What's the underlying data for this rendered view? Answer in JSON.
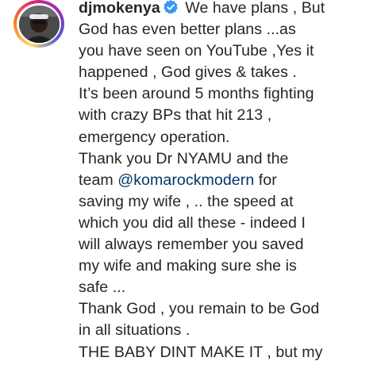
{
  "post": {
    "username": "djmokenya",
    "verified": true,
    "mention": "@komarockmodern",
    "lines": [
      " We have plans , But",
      "God has even better plans ...as",
      "you have seen on YouTube ,Yes it",
      "happened , God gives & takes .",
      "It’s been around 5 months fighting",
      "with crazy BPs that hit 213 ,",
      "emergency operation.",
      "Thank you Dr NYAMU and the",
      "team ",
      " for",
      "saving my wife , .. the speed at",
      "which you did all these - indeed I",
      "will always remember you saved",
      "my wife and making sure she is",
      "safe ...",
      "Thank God , you remain to be God",
      "in all situations .",
      "THE BABY DINT MAKE IT , but my"
    ]
  },
  "colors": {
    "text": "#262626",
    "mention": "#00376b",
    "verified_badge": "#3897f0"
  },
  "icons": {
    "verified": "verified-badge-icon",
    "avatar": "profile-avatar"
  }
}
